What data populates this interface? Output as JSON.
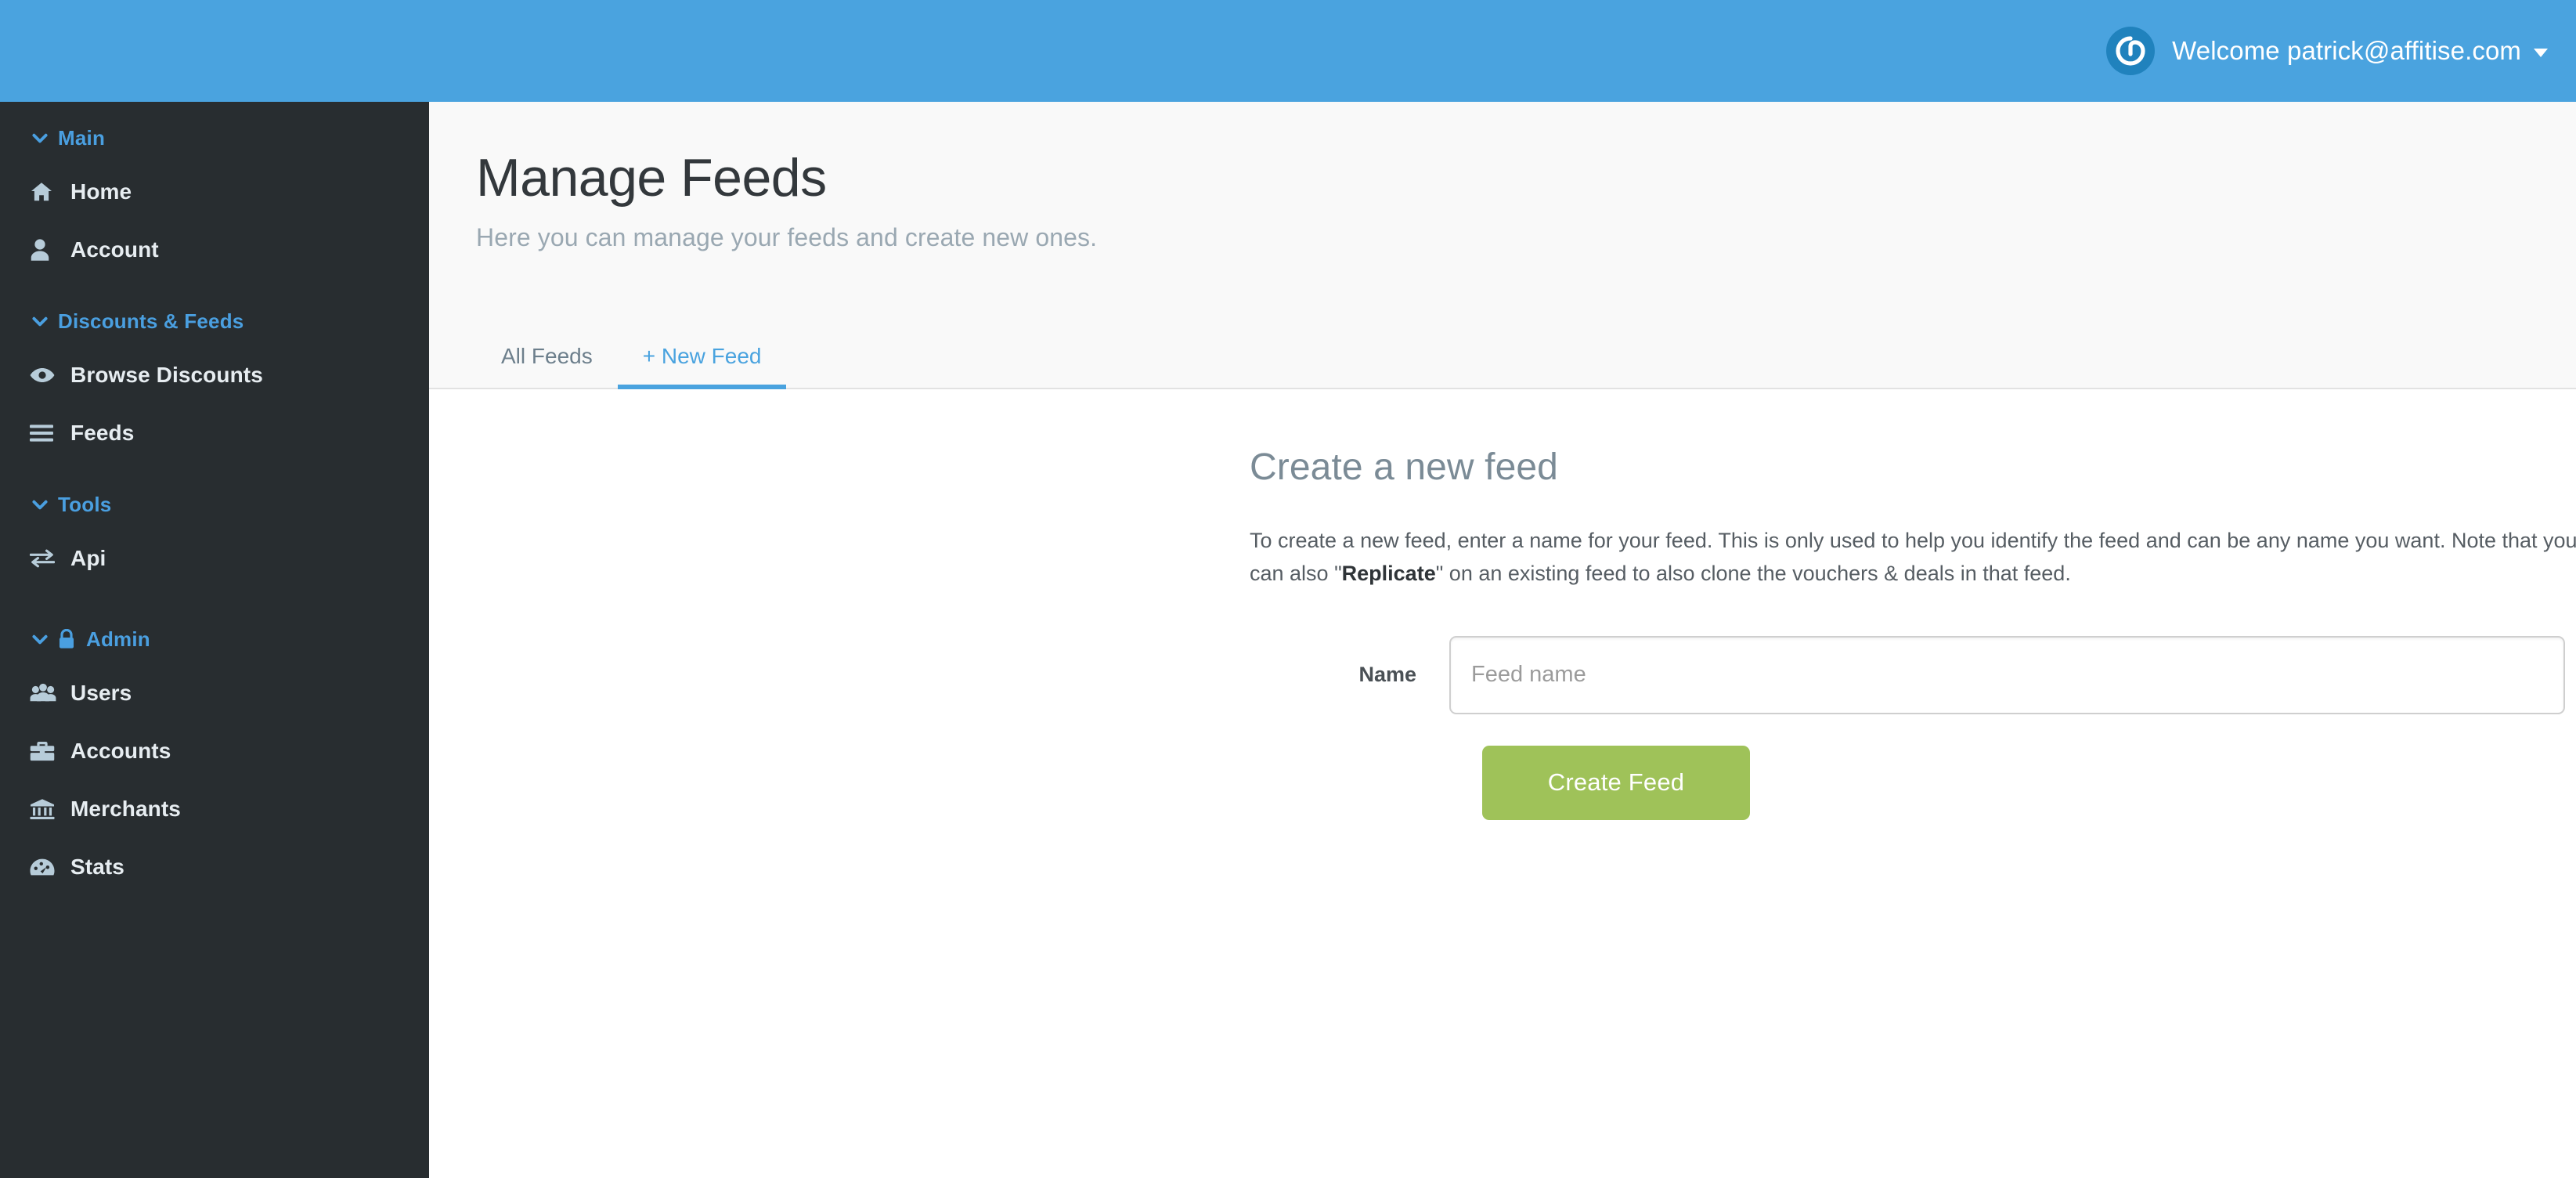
{
  "header": {
    "logo_icon": "affitise-power-logo-icon",
    "welcome_text": "Welcome patrick@affitise.com",
    "caret_icon": "caret-down-icon",
    "brand_color": "#4aa3df",
    "logo_badge_color": "#2082bd"
  },
  "sidebar": {
    "background_color": "#282d30",
    "section_color": "#4a9fe0",
    "groups": [
      {
        "label": "Main",
        "chevron_icon": "chevron-down-icon",
        "locked": false,
        "items": [
          {
            "label": "Home",
            "icon": "home-icon"
          },
          {
            "label": "Account",
            "icon": "user-icon"
          }
        ]
      },
      {
        "label": "Discounts & Feeds",
        "chevron_icon": "chevron-down-icon",
        "locked": false,
        "items": [
          {
            "label": "Browse Discounts",
            "icon": "eye-icon"
          },
          {
            "label": "Feeds",
            "icon": "list-bars-icon"
          }
        ]
      },
      {
        "label": "Tools",
        "chevron_icon": "chevron-down-icon",
        "locked": false,
        "items": [
          {
            "label": "Api",
            "icon": "exchange-arrows-icon"
          }
        ]
      },
      {
        "label": "Admin",
        "chevron_icon": "chevron-down-icon",
        "locked": true,
        "lock_icon": "lock-icon",
        "items": [
          {
            "label": "Users",
            "icon": "users-group-icon"
          },
          {
            "label": "Accounts",
            "icon": "briefcase-icon"
          },
          {
            "label": "Merchants",
            "icon": "bank-icon"
          },
          {
            "label": "Stats",
            "icon": "tachometer-icon"
          }
        ]
      }
    ]
  },
  "page": {
    "title": "Manage Feeds",
    "subtitle": "Here you can manage your feeds and create new ones.",
    "tabs": [
      {
        "label": "All Feeds",
        "active": false
      },
      {
        "label": "+ New Feed",
        "active": true
      }
    ],
    "active_tab_color": "#4aa3df"
  },
  "form": {
    "title": "Create a new feed",
    "description_part1": "To create a new feed, enter a name for your feed. This is only used to help you identify the feed and can be any name you want. Note that you can also \"",
    "description_bold": "Replicate",
    "description_part2": "\" on an existing feed to also clone the vouchers & deals in that feed.",
    "name_label": "Name",
    "name_value": "",
    "name_placeholder": "Feed name",
    "submit_label": "Create Feed",
    "submit_color": "#9fc259"
  }
}
